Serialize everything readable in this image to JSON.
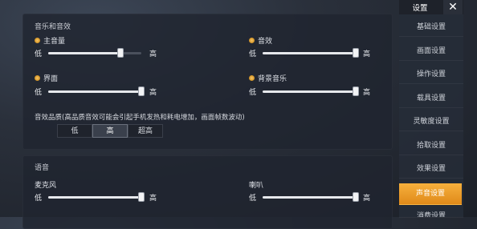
{
  "audio": {
    "section_title": "音乐和音效",
    "low": "低",
    "high": "高",
    "sliders": [
      {
        "label": "主音量",
        "value": 0.78
      },
      {
        "label": "音效",
        "value": 1.0
      },
      {
        "label": "界面",
        "value": 1.0
      },
      {
        "label": "背景音乐",
        "value": 1.0
      }
    ],
    "quality_note": "音效品质(高品质音效可能会引起手机发热和耗电增加，画面帧数波动)",
    "quality_options": [
      "低",
      "高",
      "超高"
    ],
    "quality_selected": "高"
  },
  "voice": {
    "section_title": "语音",
    "sliders": [
      {
        "label": "麦克风",
        "value": 1.0
      },
      {
        "label": "喇叭",
        "value": 1.0
      }
    ]
  },
  "sidebar": {
    "title": "设置",
    "close_icon": "close-icon",
    "items": [
      "基础设置",
      "画面设置",
      "操作设置",
      "载具设置",
      "灵敏度设置",
      "拾取设置",
      "效果设置",
      "声音设置",
      "消费设置"
    ],
    "active": "声音设置"
  }
}
